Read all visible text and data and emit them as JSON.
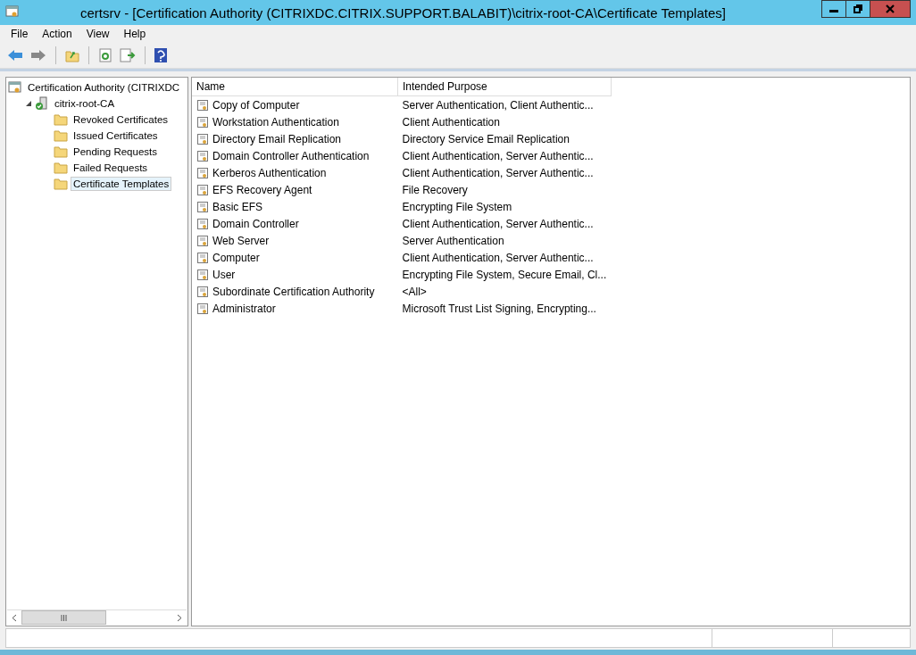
{
  "window": {
    "title": "certsrv - [Certification Authority (CITRIXDC.CITRIX.SUPPORT.BALABIT)\\citrix-root-CA\\Certificate Templates]"
  },
  "menu": [
    "File",
    "Action",
    "View",
    "Help"
  ],
  "tree": {
    "label": "Certification Authority (CITRIXDC",
    "selected": false,
    "children": [
      {
        "label": "citrix-root-CA",
        "kind": "server",
        "expanded": true,
        "selected": false,
        "children": [
          {
            "label": "Revoked Certificates",
            "kind": "folder",
            "selected": false
          },
          {
            "label": "Issued Certificates",
            "kind": "folder",
            "selected": false
          },
          {
            "label": "Pending Requests",
            "kind": "folder",
            "selected": false
          },
          {
            "label": "Failed Requests",
            "kind": "folder",
            "selected": false
          },
          {
            "label": "Certificate Templates",
            "kind": "folder",
            "selected": true
          }
        ]
      }
    ]
  },
  "table": {
    "columns": [
      "Name",
      "Intended Purpose"
    ],
    "rows": [
      [
        "Copy of Computer",
        "Server Authentication, Client Authentic..."
      ],
      [
        "Workstation Authentication",
        "Client Authentication"
      ],
      [
        "Directory Email Replication",
        "Directory Service Email Replication"
      ],
      [
        "Domain Controller Authentication",
        "Client Authentication, Server Authentic..."
      ],
      [
        "Kerberos Authentication",
        "Client Authentication, Server Authentic..."
      ],
      [
        "EFS Recovery Agent",
        "File Recovery"
      ],
      [
        "Basic EFS",
        "Encrypting File System"
      ],
      [
        "Domain Controller",
        "Client Authentication, Server Authentic..."
      ],
      [
        "Web Server",
        "Server Authentication"
      ],
      [
        "Computer",
        "Client Authentication, Server Authentic..."
      ],
      [
        "User",
        "Encrypting File System, Secure Email, Cl..."
      ],
      [
        "Subordinate Certification Authority",
        "<All>"
      ],
      [
        "Administrator",
        "Microsoft Trust List Signing, Encrypting..."
      ]
    ]
  }
}
